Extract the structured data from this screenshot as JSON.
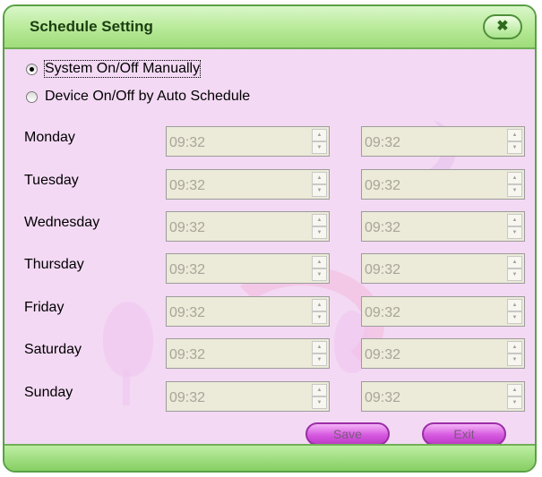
{
  "window": {
    "title": "Schedule Setting"
  },
  "mode": {
    "options": [
      {
        "label": "System On/Off Manually",
        "selected": true
      },
      {
        "label": "Device On/Off by Auto Schedule",
        "selected": false
      }
    ]
  },
  "schedule": {
    "days": [
      {
        "day": "Monday",
        "on": "09:32",
        "off": "09:32"
      },
      {
        "day": "Tuesday",
        "on": "09:32",
        "off": "09:32"
      },
      {
        "day": "Wednesday",
        "on": "09:32",
        "off": "09:32"
      },
      {
        "day": "Thursday",
        "on": "09:32",
        "off": "09:32"
      },
      {
        "day": "Friday",
        "on": "09:32",
        "off": "09:32"
      },
      {
        "day": "Saturday",
        "on": "09:32",
        "off": "09:32"
      },
      {
        "day": "Sunday",
        "on": "09:32",
        "off": "09:32"
      }
    ]
  },
  "buttons": {
    "save": "Save",
    "exit": "Exit"
  },
  "icons": {
    "close": "close-icon",
    "spin_up": "spin-up-icon",
    "spin_down": "spin-down-icon"
  },
  "colors": {
    "titlebar": "#b5e896",
    "body": "#f3d9f4",
    "button": "#d659e0"
  }
}
